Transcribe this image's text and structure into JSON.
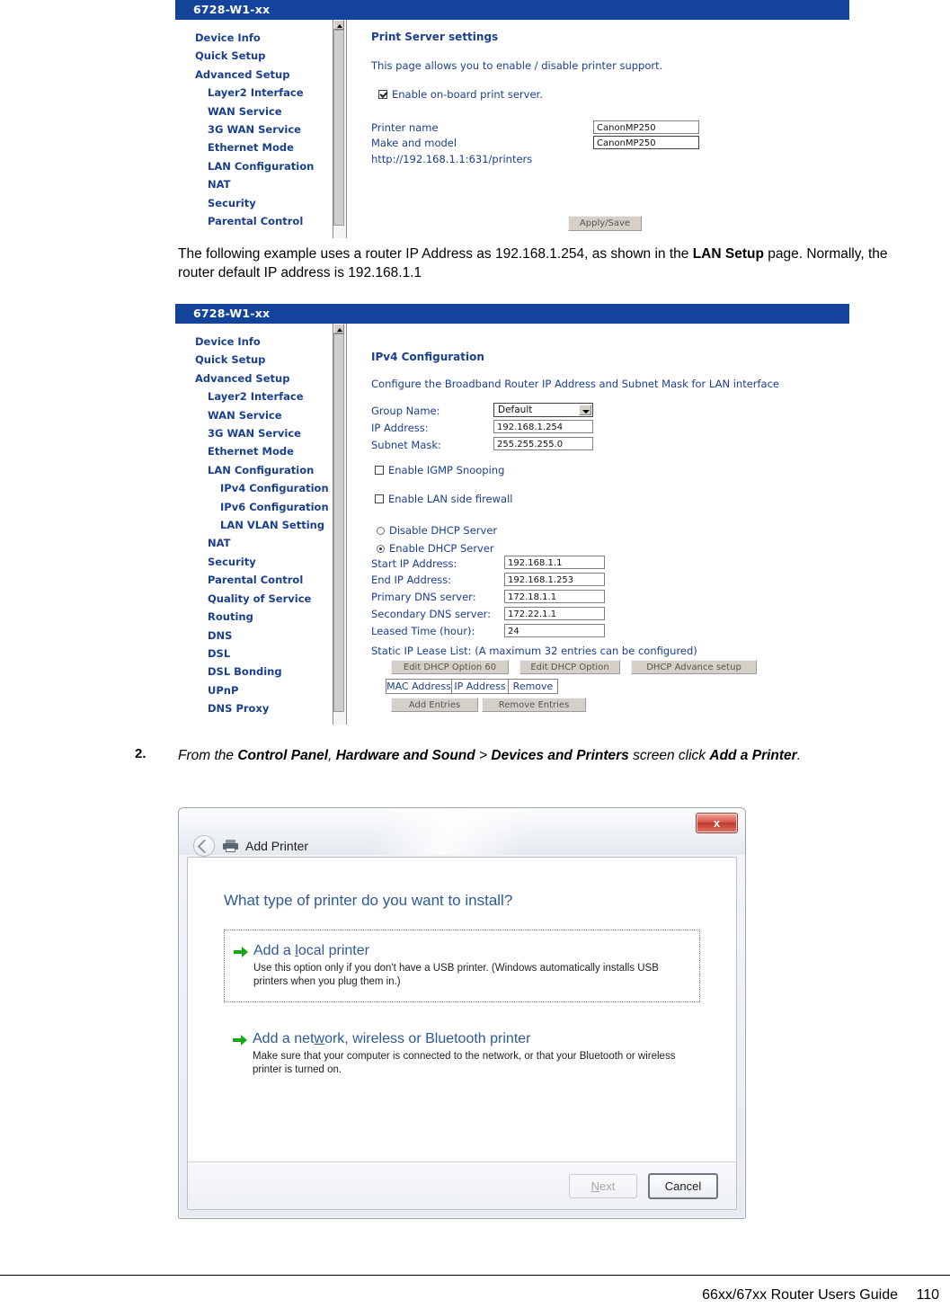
{
  "panel1": {
    "title": "6728-W1-xx",
    "nav": [
      {
        "label": "Device Info",
        "level": 0
      },
      {
        "label": "Quick Setup",
        "level": 0
      },
      {
        "label": "Advanced Setup",
        "level": 0
      },
      {
        "label": "Layer2 Interface",
        "level": 1
      },
      {
        "label": "WAN Service",
        "level": 1
      },
      {
        "label": "3G WAN Service",
        "level": 1
      },
      {
        "label": "Ethernet Mode",
        "level": 1
      },
      {
        "label": "LAN Configuration",
        "level": 1
      },
      {
        "label": "NAT",
        "level": 1
      },
      {
        "label": "Security",
        "level": 1
      },
      {
        "label": "Parental Control",
        "level": 1
      }
    ],
    "heading": "Print Server settings",
    "description": "This page allows you to enable / disable printer support.",
    "enable_checkbox_label": "Enable on-board print server.",
    "enable_checkbox_checked": true,
    "printer_name_label": "Printer name",
    "printer_name_value": "CanonMP250",
    "make_model_label": "Make and model",
    "make_model_value": "CanonMP250",
    "url_text": "http://192.168.1.1:631/printers",
    "apply_button": "Apply/Save"
  },
  "paragraph1": {
    "part1": "The following example uses a router IP Address as 192.168.1.254, as shown in the ",
    "bold1": "LAN Setup",
    "part2": " page.  Normally, the router default IP address is 192.168.1.1"
  },
  "panel2": {
    "title": "6728-W1-xx",
    "nav": [
      {
        "label": "Device Info",
        "level": 0
      },
      {
        "label": "Quick Setup",
        "level": 0
      },
      {
        "label": "Advanced Setup",
        "level": 0
      },
      {
        "label": "Layer2 Interface",
        "level": 1
      },
      {
        "label": "WAN Service",
        "level": 1
      },
      {
        "label": "3G WAN Service",
        "level": 1
      },
      {
        "label": "Ethernet Mode",
        "level": 1
      },
      {
        "label": "LAN Configuration",
        "level": 1
      },
      {
        "label": "IPv4 Configuration",
        "level": 2
      },
      {
        "label": "IPv6 Configuration",
        "level": 2
      },
      {
        "label": "LAN VLAN Setting",
        "level": 2
      },
      {
        "label": "NAT",
        "level": 1
      },
      {
        "label": "Security",
        "level": 1
      },
      {
        "label": "Parental Control",
        "level": 1
      },
      {
        "label": "Quality of Service",
        "level": 1
      },
      {
        "label": "Routing",
        "level": 1
      },
      {
        "label": "DNS",
        "level": 1
      },
      {
        "label": "DSL",
        "level": 1
      },
      {
        "label": "DSL Bonding",
        "level": 1
      },
      {
        "label": "UPnP",
        "level": 1
      },
      {
        "label": "DNS Proxy",
        "level": 1
      }
    ],
    "heading": "IPv4 Configuration",
    "description": "Configure the Broadband Router IP Address and Subnet Mask for LAN interface",
    "group_name_label": "Group Name:",
    "group_name_value": "Default",
    "ip_address_label": "IP Address:",
    "ip_address_value": "192.168.1.254",
    "subnet_mask_label": "Subnet Mask:",
    "subnet_mask_value": "255.255.255.0",
    "igmp_label": "Enable IGMP Snooping",
    "igmp_checked": false,
    "firewall_label": "Enable LAN side firewall",
    "firewall_checked": false,
    "dhcp_disable_label": "Disable DHCP Server",
    "dhcp_enable_label": "Enable DHCP Server",
    "dhcp_selected": "enable",
    "start_ip_label": "Start IP Address:",
    "start_ip_value": "192.168.1.1",
    "end_ip_label": "End IP Address:",
    "end_ip_value": "192.168.1.253",
    "primary_dns_label": "Primary DNS server:",
    "primary_dns_value": "172.18.1.1",
    "secondary_dns_label": "Secondary DNS server:",
    "secondary_dns_value": "172.22.1.1",
    "leased_time_label": "Leased Time (hour):",
    "leased_time_value": "24",
    "static_lease_label": "Static IP Lease List: (A maximum 32 entries can be configured)",
    "btn_edit_opt60": "Edit DHCP Option 60",
    "btn_edit_opt": "Edit DHCP Option",
    "btn_dhcp_advance": "DHCP Advance setup",
    "table_headers": [
      "MAC Address",
      "IP Address",
      "Remove"
    ],
    "btn_add_entries": "Add Entries",
    "btn_remove_entries": "Remove Entries"
  },
  "step2": {
    "number": "2.",
    "part1": "From the ",
    "bold1": "Control Panel",
    "part2": ", ",
    "bold2": "Hardware and Sound",
    "part3": " > ",
    "bold3": "Devices and Printers",
    "part4": " screen click ",
    "bold4": "Add a Printer",
    "part5": "."
  },
  "add_printer": {
    "title": "Add Printer",
    "close_label": "x",
    "question": "What type of printer do you want to install?",
    "option_local_title_pre": "Add a ",
    "option_local_title_u": "l",
    "option_local_title_post": "ocal printer",
    "option_local_desc": "Use this option only if you don't have a USB printer. (Windows automatically installs USB printers when you plug them in.)",
    "option_network_title_pre": "Add a net",
    "option_network_title_u": "w",
    "option_network_title_post": "ork, wireless or Bluetooth printer",
    "option_network_desc": "Make sure that your computer is connected to the network, or that your Bluetooth or wireless printer is turned on.",
    "next_label_pre": "",
    "next_label_u": "N",
    "next_label_post": "ext",
    "cancel_label": "Cancel"
  },
  "footer": {
    "guide": "66xx/67xx Router Users Guide",
    "page": "110"
  },
  "colors": {
    "router_titlebar": "#13439b",
    "router_link": "#1b3f8f",
    "wizard_heading": "#2f5a96",
    "arrow_green": "#17a81a",
    "close_red": "#c0392b"
  }
}
